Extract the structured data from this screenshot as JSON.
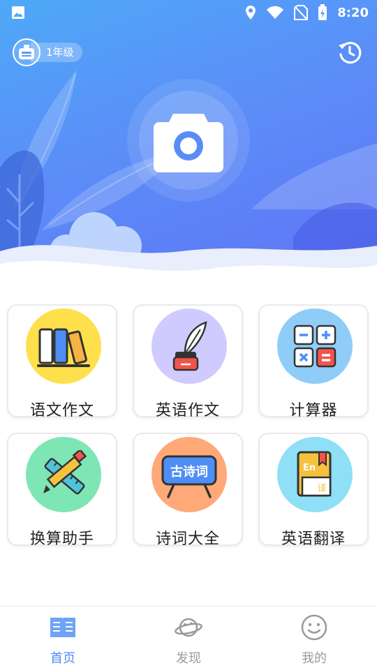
{
  "status_bar": {
    "time": "8:20",
    "icons": [
      "image-icon",
      "location-icon",
      "wifi-icon",
      "no-sim-icon",
      "battery-charging-icon"
    ]
  },
  "header": {
    "grade_label": "1年级",
    "grade_icon": "robot-avatar-icon",
    "history_icon": "history-icon"
  },
  "hero": {
    "camera_icon": "camera-icon",
    "colors": {
      "gradient_start": "#4ea9f7",
      "gradient_end": "#5f73f5"
    }
  },
  "features": [
    {
      "label": "语文作文",
      "icon": "books-icon",
      "color": "#fde04c"
    },
    {
      "label": "英语作文",
      "icon": "quill-ink-icon",
      "color": "#cfcbff"
    },
    {
      "label": "计算器",
      "icon": "calculator-icon",
      "color": "#8fcdf8"
    },
    {
      "label": "换算助手",
      "icon": "pencil-ruler-icon",
      "color": "#7ee6b4"
    },
    {
      "label": "诗词大全",
      "icon": "poetry-board-icon",
      "color": "#ffa978"
    },
    {
      "label": "英语翻译",
      "icon": "dictionary-icon",
      "color": "#8fdff7"
    }
  ],
  "features_extra": {
    "poetry_board_text": "古诗词",
    "dictionary_text": "En",
    "dictionary_sub": "译"
  },
  "bottom_nav": {
    "items": [
      {
        "label": "首页",
        "icon": "book-open-icon",
        "active": true
      },
      {
        "label": "发现",
        "icon": "planet-icon",
        "active": false
      },
      {
        "label": "我的",
        "icon": "smiley-icon",
        "active": false
      }
    ],
    "active_color": "#4d8cf5",
    "inactive_color": "#9a9a9a"
  }
}
